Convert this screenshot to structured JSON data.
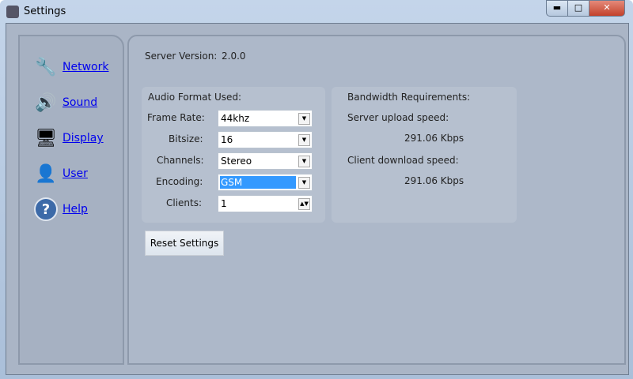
{
  "window": {
    "title": "Settings",
    "minimize": "▬",
    "maximize": "□",
    "close": "✕"
  },
  "sidebar": {
    "items": [
      {
        "label": "Network",
        "icon": "🔧"
      },
      {
        "label": "Sound",
        "icon": "🔊"
      },
      {
        "label": "Display",
        "icon": "🖥"
      },
      {
        "label": "User",
        "icon": "👤"
      },
      {
        "label": "Help",
        "icon": "?"
      }
    ]
  },
  "server": {
    "label": "Server Version:",
    "value": "2.0.0"
  },
  "audio": {
    "title": "Audio Format Used:",
    "fields": [
      {
        "label": "Frame Rate:",
        "value": "44khz"
      },
      {
        "label": "Bitsize:",
        "value": "16"
      },
      {
        "label": "Channels:",
        "value": "Stereo"
      },
      {
        "label": "Encoding:",
        "value": "GSM"
      },
      {
        "label": "Clients:",
        "value": "1"
      }
    ]
  },
  "bandwidth": {
    "title": "Bandwidth Requirements:",
    "upload_label": "Server upload speed:",
    "upload_value": "291.06 Kbps",
    "download_label": "Client download speed:",
    "download_value": "291.06 Kbps"
  },
  "reset_label": "Reset Settings"
}
